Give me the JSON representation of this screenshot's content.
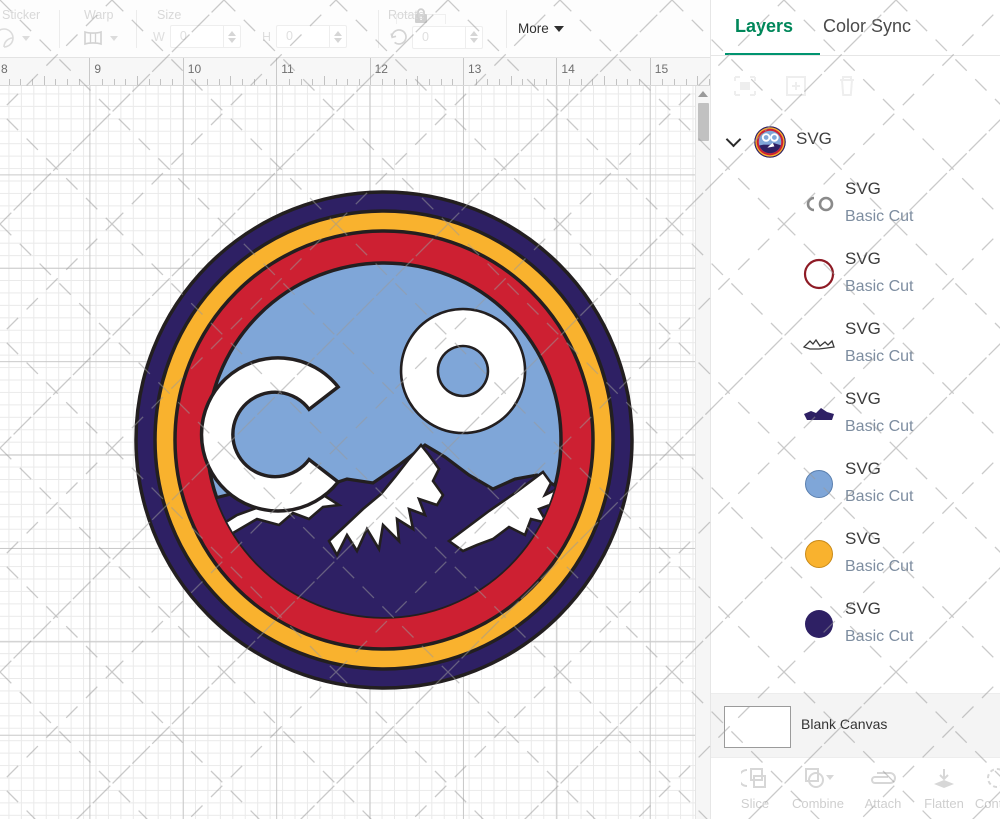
{
  "toolbar": {
    "groups": [
      {
        "label": "Sticker",
        "icon": "sticker-icon",
        "has_caret": true
      },
      {
        "label": "Warp",
        "icon": "warp-icon",
        "has_caret": true
      },
      {
        "label": "Size",
        "icon": "size-fields"
      },
      {
        "label": "Rotate",
        "icon": "rotate-icon"
      }
    ],
    "size": {
      "label": "Size",
      "width_letter": "W",
      "width_value": "0",
      "height_letter": "H",
      "height_value": "0",
      "lock_icon": "lock-icon"
    },
    "rotate": {
      "label": "Rotate",
      "value": "0",
      "icon": "rotate-icon"
    },
    "more": {
      "label": "More",
      "caret_icon": "chevron-down-icon"
    }
  },
  "ruler": {
    "unit_marks": [
      "8",
      "9",
      "10",
      "11",
      "12",
      "13",
      "14",
      "15"
    ]
  },
  "canvas": {
    "scrollbar": {
      "up_icon": "scroll-up-arrow-icon"
    },
    "artwork": {
      "name": "colorado-logo",
      "colors": {
        "outline": "#231f20",
        "navy": "#2e2064",
        "gold": "#f9b22e",
        "red": "#cd2032",
        "sky": "#7fa6d8",
        "snow": "#ffffff"
      },
      "letters": "CO"
    }
  },
  "panel": {
    "tabs": [
      {
        "label": "Layers",
        "active": true
      },
      {
        "label": "Color Sync",
        "active": false
      }
    ],
    "actions": [
      {
        "name": "group-icon",
        "enabled": false
      },
      {
        "name": "duplicate-icon",
        "enabled": false
      },
      {
        "name": "delete-icon",
        "enabled": false
      }
    ],
    "group": {
      "name": "SVG",
      "expanded": true,
      "chevron_icon": "chevron-down-icon",
      "thumbnail": "colorado-logo-thumb"
    },
    "layers": [
      {
        "title": "SVG",
        "subtitle": "Basic Cut",
        "thumb": "co-letters-thumb"
      },
      {
        "title": "SVG",
        "subtitle": "Basic Cut",
        "thumb": "red-ring-thumb"
      },
      {
        "title": "SVG",
        "subtitle": "Basic Cut",
        "thumb": "snowcaps-thumb"
      },
      {
        "title": "SVG",
        "subtitle": "Basic Cut",
        "thumb": "navy-mountain-thumb"
      },
      {
        "title": "SVG",
        "subtitle": "Basic Cut",
        "thumb": "sky-circle-thumb"
      },
      {
        "title": "SVG",
        "subtitle": "Basic Cut",
        "thumb": "gold-circle-thumb"
      },
      {
        "title": "SVG",
        "subtitle": "Basic Cut",
        "thumb": "navy-circle-thumb"
      }
    ],
    "blank_canvas": {
      "label": "Blank Canvas",
      "thumb": "blank-canvas-thumb"
    },
    "bottom_tools": [
      {
        "label": "Slice",
        "icon": "slice-icon",
        "caret": false
      },
      {
        "label": "Combine",
        "icon": "combine-icon",
        "caret": true
      },
      {
        "label": "Attach",
        "icon": "attach-icon",
        "caret": false
      },
      {
        "label": "Flatten",
        "icon": "flatten-icon",
        "caret": false
      },
      {
        "label": "Contour",
        "icon": "contour-icon",
        "caret": false
      }
    ]
  }
}
